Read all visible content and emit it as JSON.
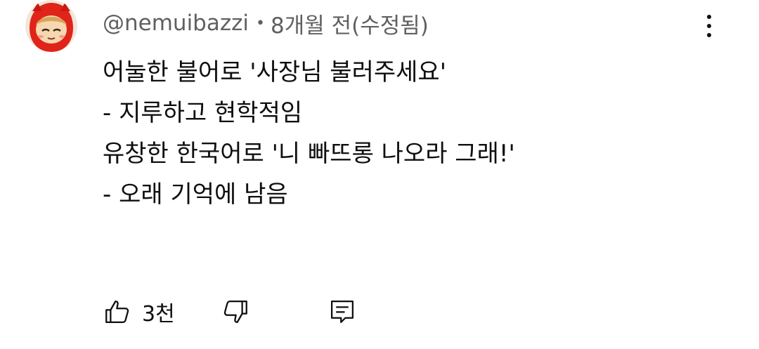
{
  "comment": {
    "author": "@nemuibazzi",
    "separator": "•",
    "time": "8개월 전(수정됨)",
    "lines": [
      "어눌한 불어로 '사장님 불러주세요'",
      "- 지루하고 현학적임",
      "유창한 한국어로 '니 빠뜨롱 나오라 그래!'",
      "- 오래 기억에 남음"
    ]
  },
  "actions": {
    "like_count": "3천"
  },
  "icons": {
    "like": "thumbs-up-icon",
    "dislike": "thumbs-down-icon",
    "reply": "comment-icon",
    "more": "more-vert-icon"
  },
  "colors": {
    "text": "#0f0f0f",
    "meta": "#606060",
    "avatar_red": "#e0241a"
  }
}
